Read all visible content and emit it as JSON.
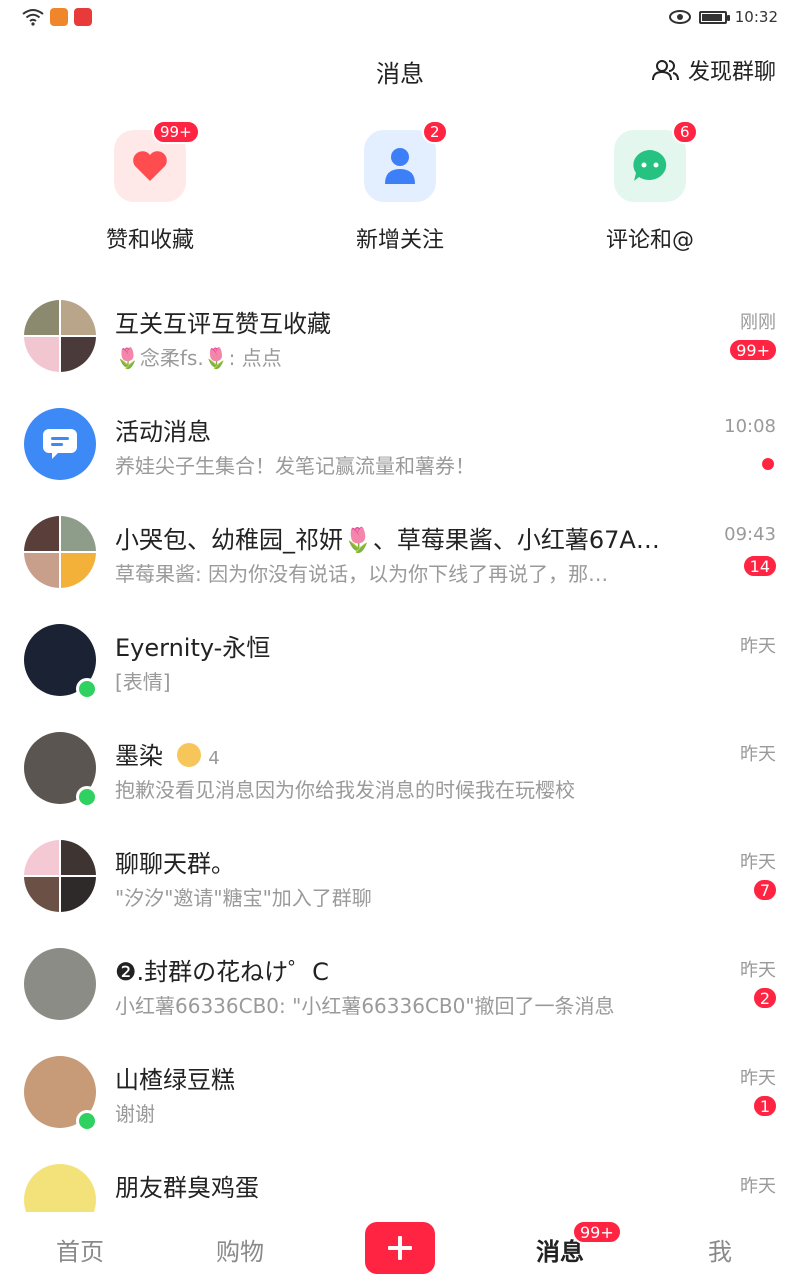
{
  "status_bar": {
    "time": "10:32"
  },
  "header": {
    "title": "消息",
    "discover_label": "发现群聊"
  },
  "quick_actions": [
    {
      "label": "赞和收藏",
      "badge": "99+",
      "icon": "heart-icon",
      "color": "#ff4d4f"
    },
    {
      "label": "新增关注",
      "badge": "2",
      "icon": "person-icon",
      "color": "#3d7ff7"
    },
    {
      "label": "评论和@",
      "badge": "6",
      "icon": "chat-icon",
      "color": "#26c281"
    }
  ],
  "messages": [
    {
      "title": "互关互评互赞互收藏",
      "subtitle": "🌷念柔fs.🌷: 点点",
      "time": "刚刚",
      "badge": "99+"
    },
    {
      "title": "活动消息",
      "subtitle": "养娃尖子生集合！发笔记赢流量和薯券！",
      "time": "10:08",
      "badge": ""
    },
    {
      "title": "小哭包、幼稚园_祁妍🌷、草莓果酱、小红薯67A…",
      "subtitle": "草莓果酱: 因为你没有说话，以为你下线了再说了，那…",
      "time": "09:43",
      "badge": "14"
    },
    {
      "title": "Eyernity-永恒",
      "subtitle": "[表情]",
      "time": "昨天",
      "badge": ""
    },
    {
      "title": "墨染",
      "title_extra": "4",
      "subtitle": "抱歉没看见消息因为你给我发消息的时候我在玩樱校",
      "time": "昨天",
      "badge": ""
    },
    {
      "title": "聊聊天群。",
      "subtitle": "\"汐汐\"邀请\"糖宝\"加入了群聊",
      "time": "昨天",
      "badge": "7"
    },
    {
      "title": "❷.封群の花ねけ゜C",
      "subtitle": "小红薯66336CB0: \"小红薯66336CB0\"撤回了一条消息",
      "time": "昨天",
      "badge": "2"
    },
    {
      "title": "山楂绿豆糕",
      "subtitle": "谢谢",
      "time": "昨天",
      "badge": "1"
    },
    {
      "title": "朋友群臭鸡蛋",
      "subtitle": "",
      "time": "昨天",
      "badge": ""
    }
  ],
  "bottom_nav": {
    "home": "首页",
    "shop": "购物",
    "messages": "消息",
    "messages_badge": "99+",
    "me": "我"
  }
}
